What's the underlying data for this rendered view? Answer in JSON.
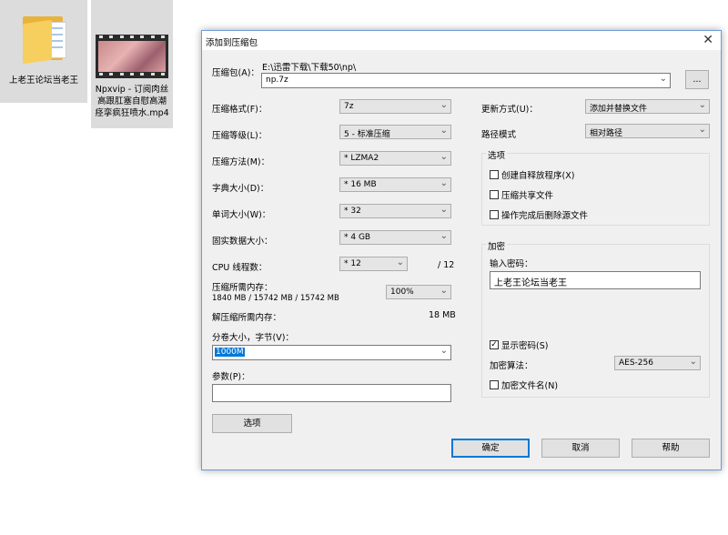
{
  "desktop": {
    "icon1_label": "上老王论坛当老王",
    "icon2_label": "Npxvip - 订阅肉丝高跟肛塞自慰高潮痉挛疯狂喷水.mp4"
  },
  "dialog": {
    "title": "添加到压缩包",
    "close": "✕",
    "archive_label": "压缩包(A)：",
    "archive_path": "E:\\迅雷下载\\下载50\\np\\",
    "archive_name": "np.7z",
    "browse_label": "...",
    "format_label": "压缩格式(F)：",
    "format_value": "7z",
    "level_label": "压缩等级(L)：",
    "level_value": "5 - 标准压缩",
    "method_label": "压缩方法(M)：",
    "method_value": "* LZMA2",
    "dict_label": "字典大小(D)：",
    "dict_value": "* 16 MB",
    "word_label": "单词大小(W)：",
    "word_value": "* 32",
    "solid_label": "固实数据大小：",
    "solid_value": "* 4 GB",
    "cpu_label": "CPU 线程数：",
    "cpu_value": "* 12",
    "cpu_total": "/ 12",
    "mem_comp_label": "压缩所需内存：",
    "mem_comp_value": "1840 MB / 15742 MB / 15742 MB",
    "mem_pct_value": "100%",
    "mem_decomp_label": "解压缩所需内存：",
    "mem_decomp_value": "18 MB",
    "split_label": "分卷大小，字节(V)：",
    "split_value": "1000M",
    "params_label": "参数(P)：",
    "params_value": "",
    "options_button": "选项",
    "update_label": "更新方式(U)：",
    "update_value": "添加并替换文件",
    "path_label": "路径模式",
    "path_value": "相对路径",
    "options_group": "选项",
    "opt_sfx": "创建自释放程序(X)",
    "opt_shared": "压缩共享文件",
    "opt_delete": "操作完成后删除源文件",
    "encrypt_group": "加密",
    "password_label": "输入密码：",
    "password_value": "上老王论坛当老王",
    "show_password": "显示密码(S)",
    "show_password_checked": "✓",
    "enc_method_label": "加密算法：",
    "enc_method_value": "AES-256",
    "encrypt_names": "加密文件名(N)",
    "ok": "确定",
    "cancel": "取消",
    "help": "帮助"
  },
  "colors": {
    "accent": "#0078d7",
    "dialog_bg": "#f0f0f0",
    "folder": "#f6cf5e"
  }
}
